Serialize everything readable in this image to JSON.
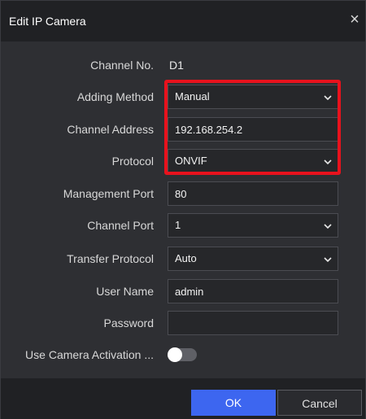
{
  "dialog": {
    "title": "Edit IP Camera",
    "close_glyph": "×",
    "close_icon": "close-icon"
  },
  "form": {
    "channel_no": {
      "label": "Channel No.",
      "value": "D1"
    },
    "adding_method": {
      "label": "Adding Method",
      "value": "Manual"
    },
    "channel_address": {
      "label": "Channel Address",
      "value": "192.168.254.2"
    },
    "protocol": {
      "label": "Protocol",
      "value": "ONVIF"
    },
    "management_port": {
      "label": "Management Port",
      "value": "80"
    },
    "channel_port": {
      "label": "Channel Port",
      "value": "1"
    },
    "transfer_protocol": {
      "label": "Transfer Protocol",
      "value": "Auto"
    },
    "user_name": {
      "label": "User Name",
      "value": "admin"
    },
    "password": {
      "label": "Password",
      "value": ""
    },
    "use_camera_activation": {
      "label": "Use Camera Activation ...",
      "enabled": false
    }
  },
  "buttons": {
    "ok_label": "OK",
    "cancel_label": "Cancel"
  },
  "colors": {
    "accent": "#3d66f0",
    "highlight_box": "#e8121d",
    "dialog_bg": "#2e2f33",
    "header_bg": "#202124"
  },
  "icons": {
    "dropdown": "chevron-down-icon"
  }
}
